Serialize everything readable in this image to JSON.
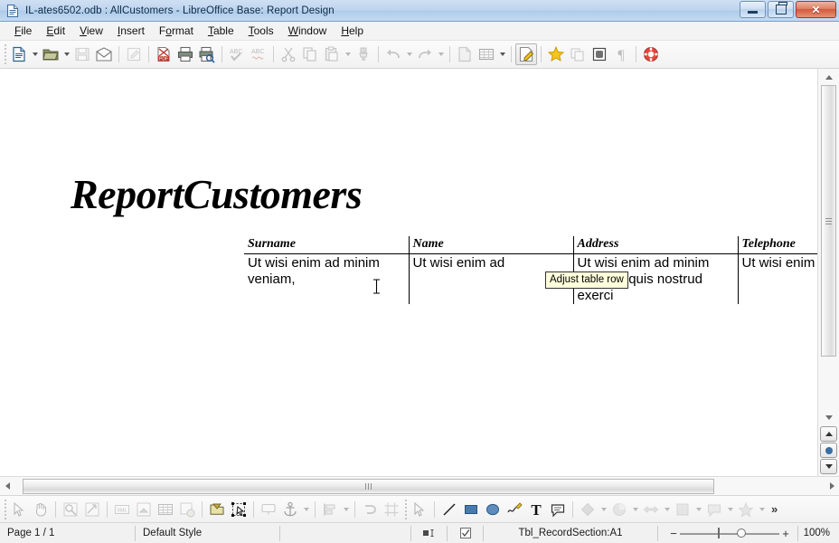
{
  "window": {
    "title": "IL-ates6502.odb : AllCustomers - LibreOffice Base: Report Design",
    "app_icon": "document-icon",
    "controls": {
      "minimize": "minimize-button",
      "restore": "restore-button",
      "close": "close-button"
    }
  },
  "menubar": {
    "items": [
      {
        "label": "File",
        "accel": "F"
      },
      {
        "label": "Edit",
        "accel": "E"
      },
      {
        "label": "View",
        "accel": "V"
      },
      {
        "label": "Insert",
        "accel": "I"
      },
      {
        "label": "Format",
        "accel": "o"
      },
      {
        "label": "Table",
        "accel": "T"
      },
      {
        "label": "Tools",
        "accel": "T"
      },
      {
        "label": "Window",
        "accel": "W"
      },
      {
        "label": "Help",
        "accel": "H"
      }
    ]
  },
  "toolbar": {
    "items": [
      {
        "name": "new-document-icon",
        "enabled": true,
        "dropdown": true
      },
      {
        "name": "open-folder-icon",
        "enabled": true,
        "dropdown": true
      },
      {
        "name": "save-icon",
        "enabled": false,
        "dropdown": false
      },
      {
        "name": "email-document-icon",
        "enabled": true,
        "dropdown": false
      },
      {
        "name": "edit-mode-icon",
        "enabled": false,
        "dropdown": false
      },
      {
        "name": "export-pdf-icon",
        "enabled": true,
        "dropdown": false
      },
      {
        "name": "print-icon",
        "enabled": true,
        "dropdown": false
      },
      {
        "name": "print-preview-icon",
        "enabled": true,
        "dropdown": false
      },
      {
        "name": "spelling-icon",
        "enabled": false,
        "dropdown": false
      },
      {
        "name": "autospellcheck-icon",
        "enabled": false,
        "dropdown": false
      },
      {
        "name": "cut-icon",
        "enabled": false,
        "dropdown": false
      },
      {
        "name": "copy-icon",
        "enabled": false,
        "dropdown": false
      },
      {
        "name": "paste-icon",
        "enabled": false,
        "dropdown": true
      },
      {
        "name": "clone-formatting-icon",
        "enabled": false,
        "dropdown": false
      },
      {
        "name": "undo-icon",
        "enabled": false,
        "dropdown": true
      },
      {
        "name": "redo-icon",
        "enabled": false,
        "dropdown": true
      },
      {
        "name": "insert-page-icon",
        "enabled": false,
        "dropdown": false
      },
      {
        "name": "insert-table-icon",
        "enabled": true,
        "dropdown": true
      },
      {
        "name": "edit-file-icon",
        "enabled": true,
        "dropdown": false,
        "pressed": true
      },
      {
        "name": "gallery-icon",
        "enabled": true,
        "dropdown": false
      },
      {
        "name": "navigator-icon",
        "enabled": false,
        "dropdown": false
      },
      {
        "name": "data-sources-icon",
        "enabled": true,
        "dropdown": false
      },
      {
        "name": "formatting-marks-icon",
        "enabled": false,
        "dropdown": false
      },
      {
        "name": "help-icon",
        "enabled": true,
        "dropdown": false
      }
    ]
  },
  "report": {
    "title": "ReportCustomers",
    "table": {
      "headers": [
        "Surname",
        "Name",
        "Address",
        "Telephone"
      ],
      "rows": [
        [
          "Ut wisi enim ad minim\nveniam,",
          "Ut wisi enim ad",
          "Ut wisi enim ad minim\nveniam, quis nostrud\nexerci",
          "Ut wisi enim"
        ]
      ]
    }
  },
  "tooltip": {
    "text": "Adjust table row"
  },
  "cursor": {
    "type": "text-ibeam-cursor"
  },
  "drawing_toolbar": {
    "items": [
      {
        "name": "select-arrow-icon",
        "enabled": false,
        "dropdown": false
      },
      {
        "name": "pan-hand-icon",
        "enabled": false,
        "dropdown": false
      },
      {
        "name": "zoom-tool-icon",
        "enabled": false,
        "dropdown": false
      },
      {
        "name": "zoom-region-icon",
        "enabled": false,
        "dropdown": false
      },
      {
        "name": "xml-source-icon",
        "enabled": false,
        "dropdown": false
      },
      {
        "name": "insert-field-icon",
        "enabled": false,
        "dropdown": false
      },
      {
        "name": "table-grid-icon",
        "enabled": false,
        "dropdown": false
      },
      {
        "name": "add-field-icon",
        "enabled": false,
        "dropdown": false
      },
      {
        "name": "report-navigator-icon",
        "enabled": true,
        "dropdown": false
      },
      {
        "name": "select-objects-icon",
        "enabled": true,
        "dropdown": false
      },
      {
        "name": "label-field-icon",
        "enabled": false,
        "dropdown": false
      },
      {
        "name": "anchor-icon",
        "enabled": false,
        "dropdown": true
      },
      {
        "name": "align-left-icon",
        "enabled": false,
        "dropdown": true
      },
      {
        "name": "send-backward-icon",
        "enabled": false,
        "dropdown": false
      },
      {
        "name": "crop-frame-icon",
        "enabled": false,
        "dropdown": false
      },
      {
        "name": "draw-select-arrow-icon",
        "enabled": false,
        "dropdown": false
      },
      {
        "name": "line-icon",
        "enabled": true,
        "dropdown": false
      },
      {
        "name": "rectangle-icon",
        "enabled": true,
        "dropdown": false
      },
      {
        "name": "ellipse-icon",
        "enabled": true,
        "dropdown": false
      },
      {
        "name": "freeform-line-icon",
        "enabled": true,
        "dropdown": false
      },
      {
        "name": "text-box-icon",
        "enabled": true,
        "dropdown": false
      },
      {
        "name": "callout-icon",
        "enabled": true,
        "dropdown": false
      },
      {
        "name": "basic-shapes-icon",
        "enabled": false,
        "dropdown": true
      },
      {
        "name": "symbol-shapes-icon",
        "enabled": false,
        "dropdown": true
      },
      {
        "name": "block-arrows-icon",
        "enabled": false,
        "dropdown": true
      },
      {
        "name": "flowchart-shapes-icon",
        "enabled": false,
        "dropdown": true
      },
      {
        "name": "callout-shapes-icon",
        "enabled": false,
        "dropdown": true
      },
      {
        "name": "stars-icon",
        "enabled": false,
        "dropdown": true
      }
    ],
    "overflow_label": "»"
  },
  "statusbar": {
    "page": "Page 1 / 1",
    "page_style": "Default Style",
    "selection_mode_icon": "selection-mode-icon",
    "modified_icon": "document-modified-icon",
    "object_info": "Tbl_RecordSection:A1",
    "zoom_minus": "−",
    "zoom_plus": "+",
    "zoom_level": "100%"
  },
  "scrollbars": {
    "vertical": {
      "up_arrow": "scroll-up-arrow",
      "down_arrow": "scroll-down-arrow",
      "prev_page": "previous-page-button",
      "navigation": "navigation-button",
      "next_page": "next-page-button"
    },
    "horizontal": {
      "left_arrow": "scroll-left-arrow",
      "right_arrow": "scroll-right-arrow"
    }
  },
  "colors": {
    "titlebar_accent": "#aecbe9",
    "close_button": "#cf5a3e",
    "tooltip_bg": "#ffffdc",
    "canvas_bg": "#ffffff",
    "chrome_bg": "#f1f1f1"
  }
}
